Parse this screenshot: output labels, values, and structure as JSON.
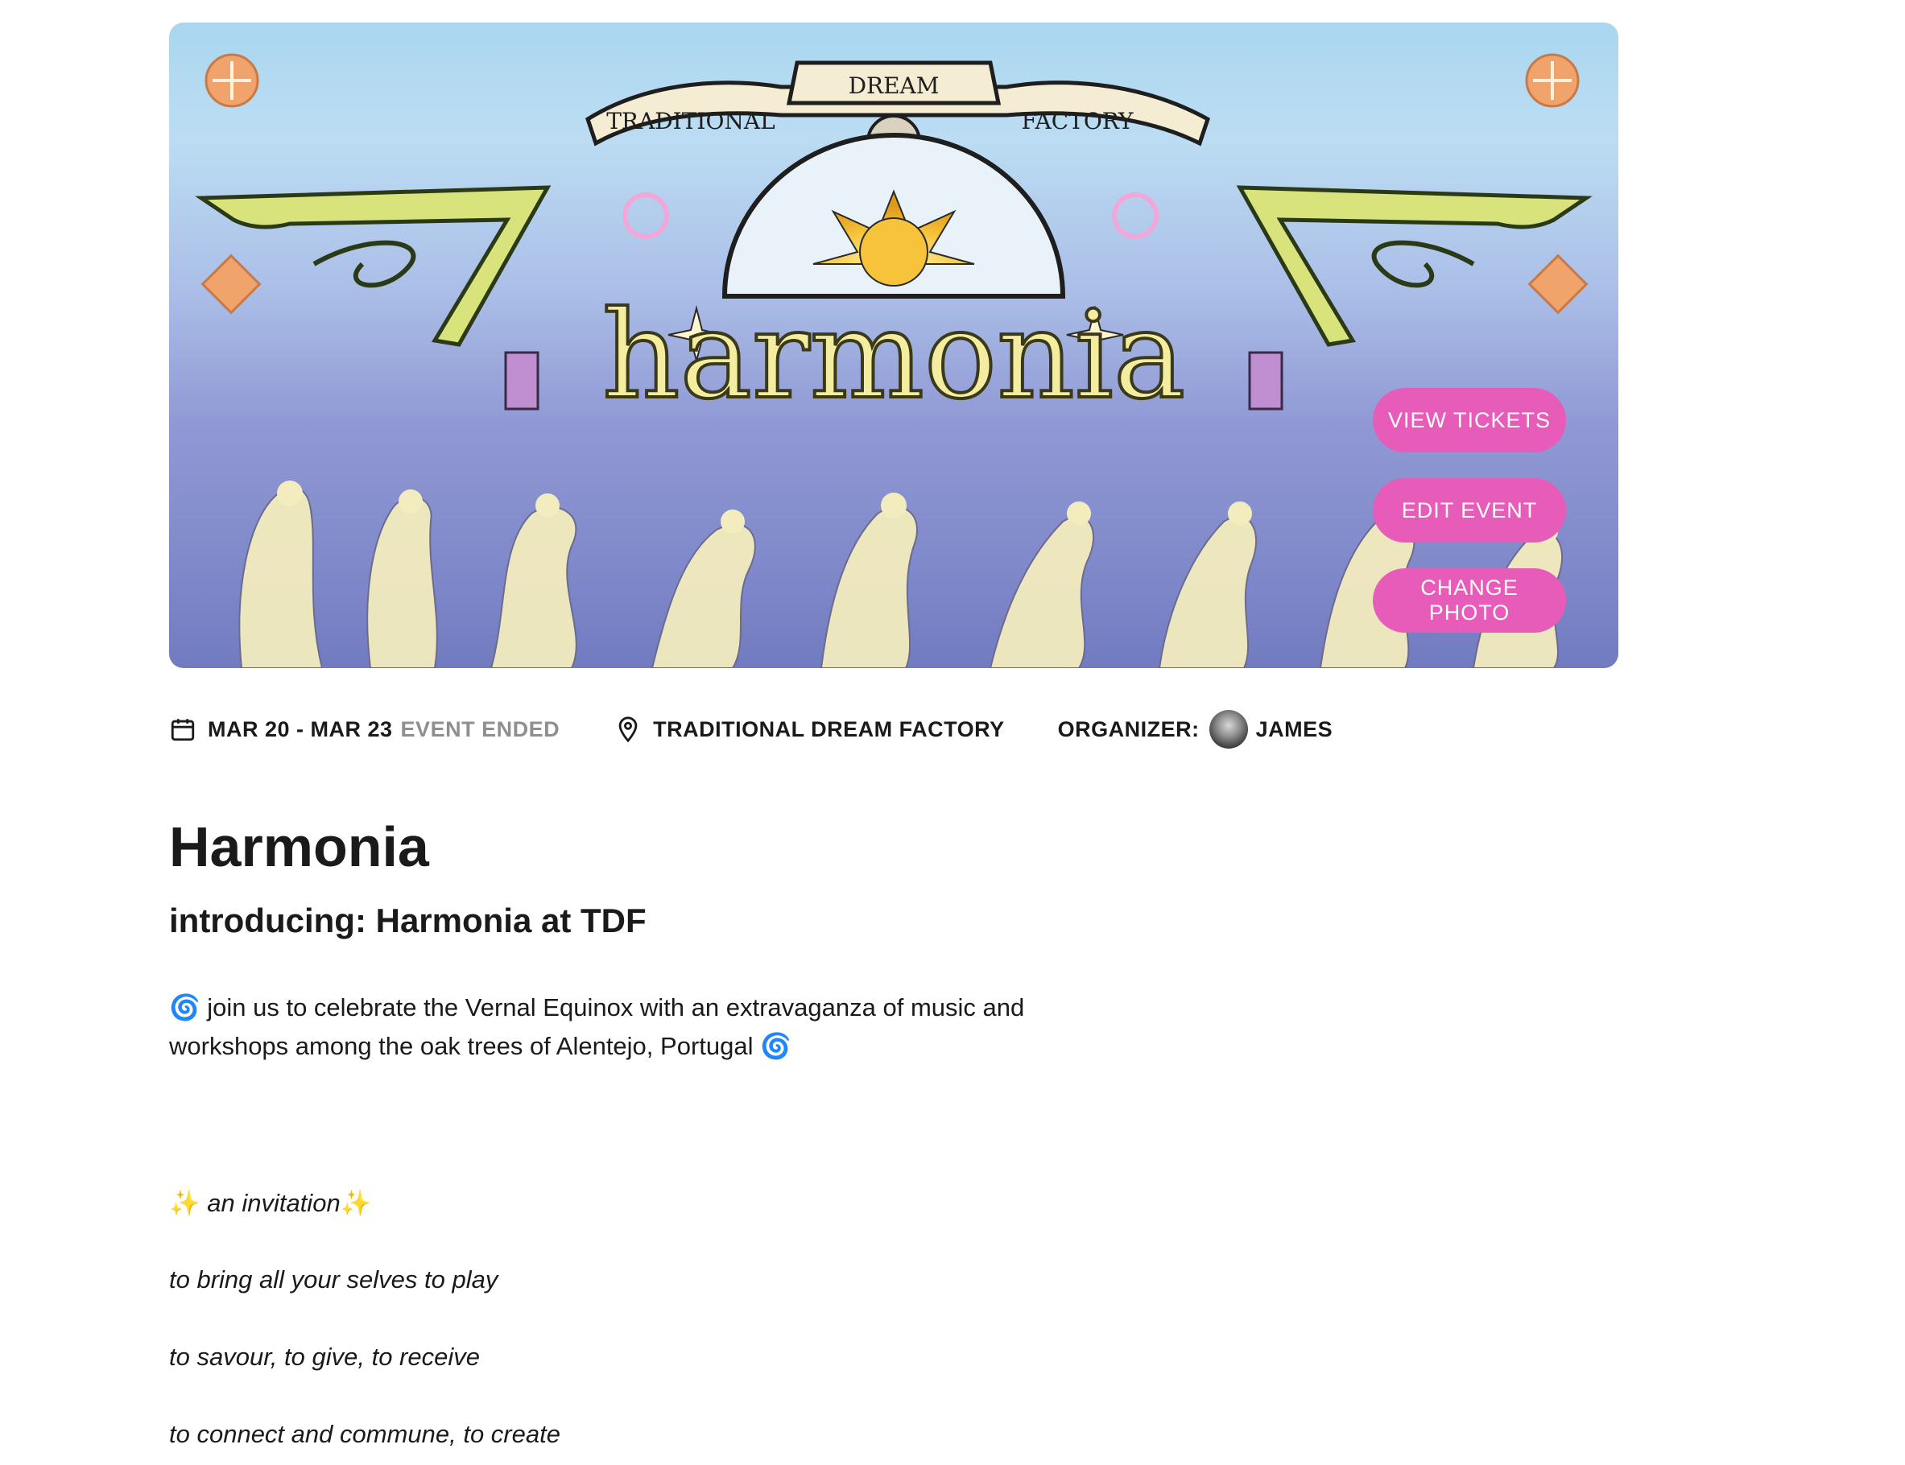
{
  "hero": {
    "banner_text": {
      "ribbon_left": "TRADITIONAL",
      "ribbon_center": "DREAM",
      "ribbon_right": "FACTORY",
      "wordmark": "harmonia"
    },
    "buttons": {
      "view_tickets": "VIEW TICKETS",
      "edit_event": "EDIT EVENT",
      "change_photo": "CHANGE PHOTO"
    },
    "accent_color": "#e85cb9"
  },
  "meta": {
    "date_range": "MAR 20 - MAR 23",
    "status": "EVENT ENDED",
    "location": "TRADITIONAL DREAM FACTORY",
    "organizer_label": "ORGANIZER:",
    "organizer_name": "JAMES"
  },
  "event": {
    "title": "Harmonia",
    "subtitle": "introducing: Harmonia at TDF",
    "description_emoji": "🌀",
    "description": "join us to celebrate the Vernal Equinox with an extravaganza of music and workshops among the oak trees of Alentejo, Portugal",
    "invitation_emoji": "✨",
    "invitation": "an invitation",
    "lines": [
      "to bring all your selves to play",
      "to savour, to give, to receive",
      "to connect and commune, to create"
    ]
  }
}
